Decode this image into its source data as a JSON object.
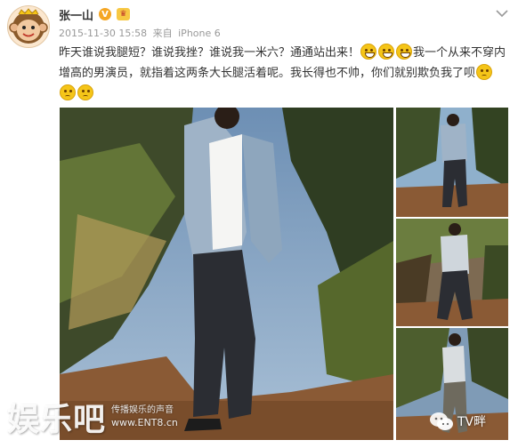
{
  "user": {
    "name": "张一山",
    "verified_badge": "V"
  },
  "meta": {
    "date": "2015-11-30 15:58",
    "from_label": "来自",
    "device": "iPhone 6"
  },
  "post": {
    "segment_1": "昨天谁说我腿短？谁说我挫？谁说我一米六？通通站出来！",
    "segment_2": "我一个从来不穿内增高的男演员，就指着这两条大长腿活着呢。我长得也不帅，你们就别欺负我了呗"
  },
  "icons": {
    "avatar": "monkey-avatar-icon",
    "verified": "verified-v-icon",
    "member": "member-crown-icon",
    "more": "chevron-down-icon",
    "laugh": "laugh-tears-emoji-icon",
    "sad": "sad-emoji-icon",
    "wechat": "wechat-bubble-icon"
  },
  "photos": [
    "photo-main",
    "photo-thumb-1",
    "photo-thumb-2",
    "photo-thumb-3"
  ],
  "watermark": {
    "logo": "娱乐吧",
    "tagline": "传播娱乐的声音",
    "site": "www.ENT8.cn",
    "tv_label": "TV畔"
  },
  "colors": {
    "name_text": "#333333",
    "meta_text": "#999999",
    "verified_badge": "#f5a623",
    "emoji_yellow": "#f5c518"
  }
}
